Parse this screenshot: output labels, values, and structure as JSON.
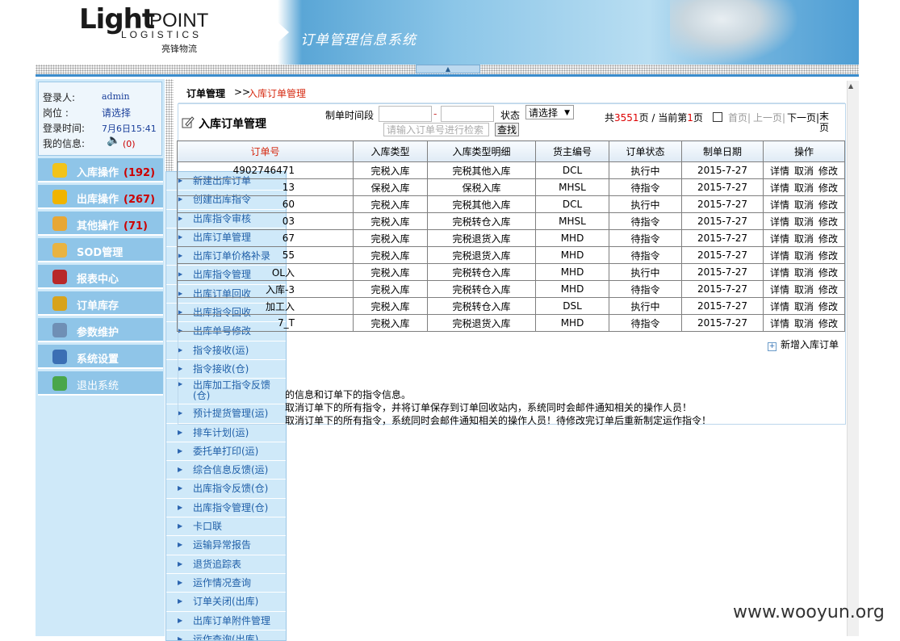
{
  "header": {
    "logo_light": "Lightpoint",
    "logo_light_text": "Light",
    "logo_point": "POINT",
    "logo_logistics": "LOGISTICS",
    "logo_cn": "亮锋物流",
    "system_title": "订单管理信息系统"
  },
  "user": {
    "login_label": "登录人:",
    "login_value": "admin",
    "post_label": "岗位  :",
    "post_value": "请选择",
    "time_label": "登录时间:",
    "time_value": "7月6日15:41",
    "msg_label": "我的信息:",
    "msg_count": "(0)"
  },
  "menu": [
    {
      "label": "入库操作",
      "count": "(192)",
      "icon": "folder-icon",
      "color": "#f2c31a"
    },
    {
      "label": "出库操作",
      "count": "(267)",
      "icon": "star-icon",
      "color": "#f0b400"
    },
    {
      "label": "其他操作",
      "count": "(71)",
      "icon": "mail-icon",
      "color": "#e8a735"
    },
    {
      "label": "SOD管理",
      "count": "",
      "icon": "sod-icon",
      "color": "#e9b341"
    },
    {
      "label": "报表中心",
      "count": "",
      "icon": "report-icon",
      "color": "#b8282a"
    },
    {
      "label": "订单库存",
      "count": "",
      "icon": "stock-icon",
      "color": "#d8a31c"
    },
    {
      "label": "参数维护",
      "count": "",
      "icon": "tools-icon",
      "color": "#6f8fb5"
    },
    {
      "label": "系统设置",
      "count": "",
      "icon": "settings-icon",
      "color": "#3b6fb4"
    },
    {
      "label": "退出系统",
      "count": "",
      "icon": "exit-icon",
      "color": "#4aa64a"
    }
  ],
  "submenu": [
    "新建出库订单",
    "创建出库指令",
    "出库指令审核",
    "出库订单管理",
    "出库订单价格补录",
    "出库指令管理",
    "出库订单回收",
    "出库指令回收",
    "出库单号修改",
    "指令接收(运)",
    "指令接收(仓)",
    "出库加工指令反馈(仓)",
    "预计提货管理(运)",
    "排车计划(运)",
    "委托单打印(运)",
    "综合信息反馈(运)",
    "出库指令反馈(仓)",
    "出库指令管理(仓)",
    "卡口联",
    "运输异常报告",
    "退货追踪表",
    "运作情况查询",
    "订单关闭(出库)",
    "出库订单附件管理",
    "运作查询(出库)"
  ],
  "breadcrumb": {
    "root": "订单管理",
    "sep": ">>",
    "current": "入库订单管理"
  },
  "page_title": "入库订单管理",
  "filters": {
    "date_label": "制单时间段",
    "dash": "-",
    "status_label": "状态",
    "status_value": "请选择",
    "search_placeholder": "请输入订单号进行检索",
    "search_button": "查找"
  },
  "pager": {
    "prefix": "共",
    "total": "3551",
    "mid": "页 / 当前第",
    "current": "1",
    "suffix": "页",
    "first": "首页|",
    "prev": "上一页|",
    "next": "下一页|",
    "last": "末页"
  },
  "table": {
    "headers": [
      "订单号",
      "入库类型",
      "入库类型明细",
      "货主编号",
      "订单状态",
      "制单日期",
      "操作"
    ],
    "rows": [
      [
        "4902746471",
        "完税入库",
        "完税其他入库",
        "DCL",
        "执行中",
        "2015-7-27",
        "详情 取消 修改"
      ],
      [
        "13",
        "保税入库",
        "保税入库",
        "MHSL",
        "待指令",
        "2015-7-27",
        "详情 取消 修改"
      ],
      [
        "60",
        "完税入库",
        "完税其他入库",
        "DCL",
        "执行中",
        "2015-7-27",
        "详情 取消 修改"
      ],
      [
        "03",
        "完税入库",
        "完税转仓入库",
        "MHSL",
        "待指令",
        "2015-7-27",
        "详情 取消 修改"
      ],
      [
        "67",
        "完税入库",
        "完税退货入库",
        "MHD",
        "待指令",
        "2015-7-27",
        "详情 取消 修改"
      ],
      [
        "55",
        "完税入库",
        "完税退货入库",
        "MHD",
        "待指令",
        "2015-7-27",
        "详情 取消 修改"
      ],
      [
        "OL入",
        "完税入库",
        "完税转仓入库",
        "MHD",
        "执行中",
        "2015-7-27",
        "详情 取消 修改"
      ],
      [
        "入库-3",
        "完税入库",
        "完税转仓入库",
        "MHD",
        "待指令",
        "2015-7-27",
        "详情 取消 修改"
      ],
      [
        "加工入",
        "完税入库",
        "完税转仓入库",
        "DSL",
        "执行中",
        "2015-7-27",
        "详情 取消 修改"
      ],
      [
        "7_T",
        "完税入库",
        "完税退货入库",
        "MHD",
        "待指令",
        "2015-7-27",
        "详情 取消 修改"
      ]
    ]
  },
  "new_order": "新增入库订单",
  "notes": [
    "的信息和订单下的指令信息。",
    "取消订单下的所有指令，并将订单保存到订单回收站内，系统同时会邮件通知相关的操作人员！",
    "取消订单下的所有指令，系统同时会邮件通知相关的操作人员！待修改完订单后重新制定运作指令！"
  ],
  "watermark": "www.wooyun.org"
}
